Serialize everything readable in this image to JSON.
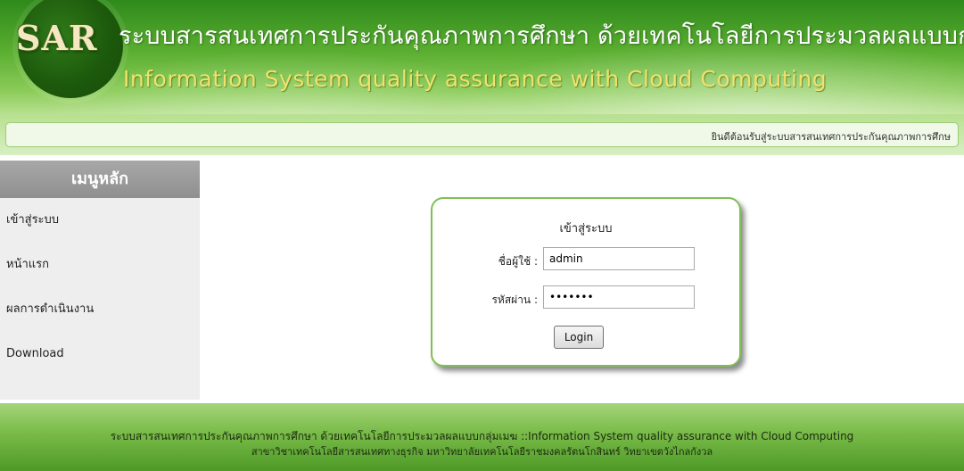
{
  "header": {
    "logo_text": "SAR",
    "title_th": "ระบบสารสนเทศการประกันคุณภาพการศึกษา ด้วยเทคโนโลยีการประมวลผลแบบกลุ่มเมฆ",
    "title_en": "Information System quality assurance with Cloud Computing"
  },
  "welcome": {
    "text": "ยินดีต้อนรับสู่ระบบสารสนเทศการประกันคุณภาพการศึกษ"
  },
  "sidebar": {
    "heading": "เมนูหลัก",
    "items": [
      {
        "label": "เข้าสู่ระบบ"
      },
      {
        "label": "หน้าแรก"
      },
      {
        "label": "ผลการดำเนินงาน"
      },
      {
        "label": "Download"
      }
    ]
  },
  "login": {
    "title": "เข้าสู่ระบบ",
    "username_label": "ชื่อผู้ใช้ :",
    "username_value": "admin",
    "password_label": "รหัสผ่าน :",
    "password_value": "1234567",
    "button_label": "Login"
  },
  "footer": {
    "line1": "ระบบสารสนเทศการประกันคุณภาพการศึกษา ด้วยเทคโนโลยีการประมวลผลแบบกลุ่มเมฆ ::Information System quality assurance with Cloud Computing",
    "line2": "สาขาวิชาเทคโนโลยีสารสนเทศทางธุรกิจ มหาวิทยาลัยเทคโนโลยีราชมงคลรัตนโกสินทร์ วิทยาเขตวังไกลกังวล"
  },
  "colors": {
    "header_green": "#5aae30",
    "title_en_yellow": "#f0e26a",
    "menu_heading_gray": "#8f8f8f",
    "login_border_green": "#7fbf55"
  }
}
